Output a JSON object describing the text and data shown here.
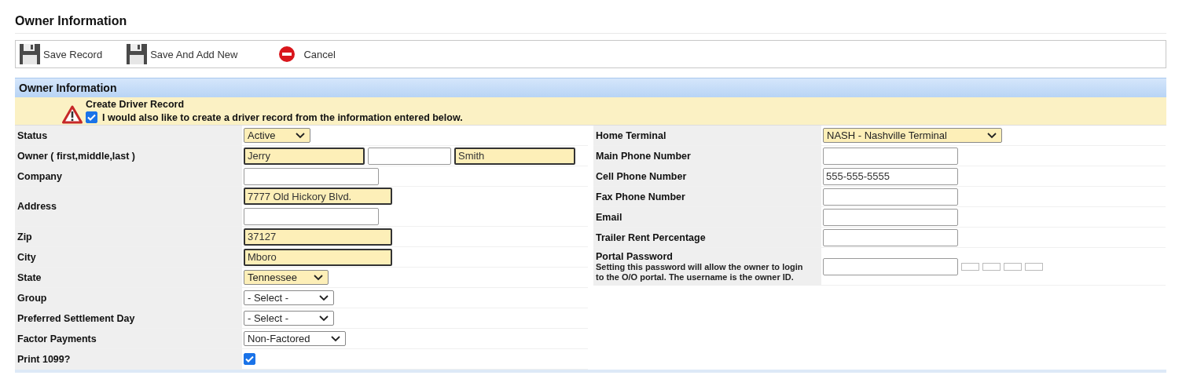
{
  "page_title": "Owner Information",
  "toolbar": [
    {
      "label": "Save Record",
      "kind": "save"
    },
    {
      "label": "Save And Add New",
      "kind": "save"
    },
    {
      "label": "Cancel",
      "kind": "cancel"
    }
  ],
  "section": {
    "title": "Owner Information",
    "notice": {
      "title": "Create Driver Record",
      "checked": true,
      "text": "I would also like to create a driver record from the information entered below."
    }
  },
  "left_rows": [
    {
      "label": "Status",
      "controls": [
        {
          "kind": "select",
          "value": "Active",
          "required": true
        }
      ]
    },
    {
      "label": "Owner ( first,middle,last )",
      "controls": [
        {
          "kind": "text",
          "value": "Jerry",
          "required": true
        },
        {
          "kind": "text",
          "required": false
        },
        {
          "kind": "text",
          "value": "Smith",
          "required": true
        }
      ]
    },
    {
      "label": "Company",
      "controls": [
        {
          "kind": "text",
          "required": false
        }
      ]
    },
    {
      "label": "Address",
      "controls": [
        {
          "kind": "text",
          "value": "7777 Old Hickory Blvd.",
          "required": true
        },
        {
          "kind": "text",
          "required": false
        }
      ]
    },
    {
      "label": "Zip",
      "controls": [
        {
          "kind": "text",
          "value": "37127",
          "required": true
        }
      ]
    },
    {
      "label": "City",
      "controls": [
        {
          "kind": "text",
          "value": "Mboro",
          "required": true
        }
      ]
    },
    {
      "label": "State",
      "controls": [
        {
          "kind": "select",
          "value": "Tennessee",
          "required": true
        }
      ]
    },
    {
      "label": "Group",
      "controls": [
        {
          "kind": "select",
          "value": "- Select -",
          "required": false
        }
      ]
    },
    {
      "label": "Preferred Settlement Day",
      "controls": [
        {
          "kind": "select",
          "value": "- Select -",
          "required": false
        }
      ]
    },
    {
      "label": "Factor Payments",
      "controls": [
        {
          "kind": "select",
          "value": "Non-Factored",
          "required": false
        }
      ]
    },
    {
      "label": "Print 1099?",
      "controls": [
        {
          "kind": "checkbox",
          "checked": true
        }
      ]
    }
  ],
  "right_rows": [
    {
      "label": "Home Terminal",
      "controls": [
        {
          "kind": "select",
          "value": "NASH - Nashville Terminal",
          "required": true
        }
      ]
    },
    {
      "label": "Main Phone Number",
      "controls": [
        {
          "kind": "text",
          "required": false
        }
      ]
    },
    {
      "label": "Cell Phone Number",
      "controls": [
        {
          "kind": "text",
          "value": "555-555-5555",
          "required": false
        }
      ]
    },
    {
      "label": "Fax Phone Number",
      "controls": [
        {
          "kind": "text",
          "required": false
        }
      ]
    },
    {
      "label": "Email",
      "controls": [
        {
          "kind": "text",
          "required": false
        }
      ]
    },
    {
      "label": "Trailer Rent Percentage",
      "controls": [
        {
          "kind": "text",
          "required": false
        }
      ]
    },
    {
      "label": "Portal Password",
      "note": "Setting this password will allow the owner to login to the O/O portal. The username is the owner ID.",
      "controls": [
        {
          "kind": "password",
          "required": false
        }
      ]
    }
  ]
}
